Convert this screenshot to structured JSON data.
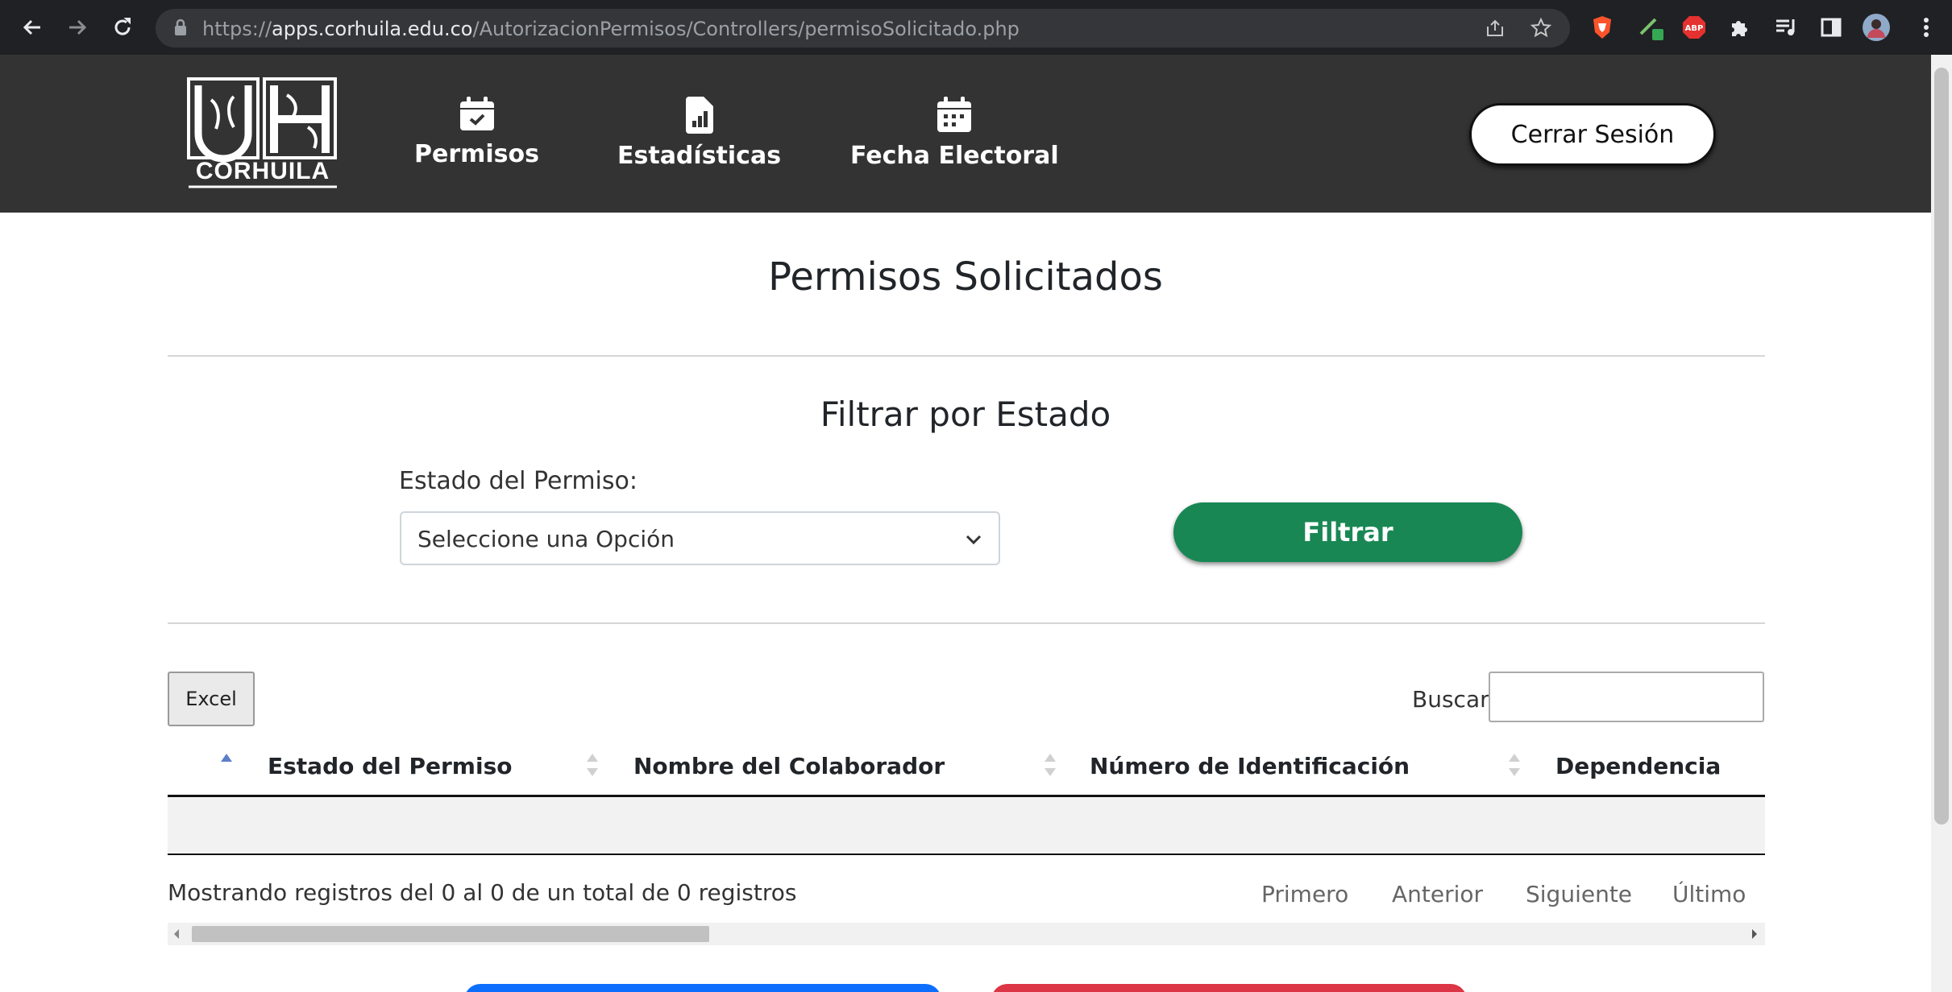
{
  "browser": {
    "url_scheme": "https://",
    "url_host": "apps.corhuila.edu.co",
    "url_path": "/AutorizacionPermisos/Controllers/permisoSolicitado.php"
  },
  "header": {
    "logo_text": "CORHUILA",
    "nav": [
      {
        "label": "Permisos",
        "icon": "calendar-check-icon"
      },
      {
        "label": "Estadísticas",
        "icon": "file-chart-icon"
      },
      {
        "label": "Fecha Electoral",
        "icon": "calendar-dots-icon"
      }
    ],
    "logout_label": "Cerrar Sesión"
  },
  "main": {
    "title": "Permisos Solicitados",
    "filter_title": "Filtrar por Estado",
    "field_label": "Estado del Permiso:",
    "select_value": "Seleccione una Opción",
    "filter_button": "Filtrar"
  },
  "table": {
    "excel_button": "Excel",
    "search_label": "Buscar:",
    "columns": [
      "Estado del Permiso",
      "Nombre del Colaborador",
      "Número de Identificación",
      "Dependencia"
    ],
    "rows": [],
    "info": "Mostrando registros del 0 al 0 de un total de 0 registros",
    "pagination": {
      "first": "Primero",
      "prev": "Anterior",
      "next": "Siguiente",
      "last": "Último"
    }
  },
  "colors": {
    "header_bg": "#333333",
    "filter_button": "#198754",
    "bottom_button_left": "#0d6efd",
    "bottom_button_right": "#dc3545"
  }
}
